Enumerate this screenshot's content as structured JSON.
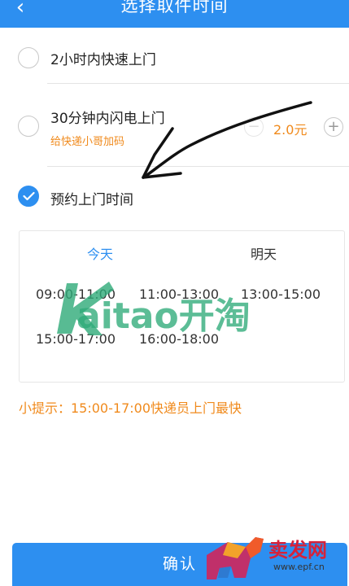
{
  "header": {
    "title": "选择取件时间",
    "back_icon": "chevron-left-icon",
    "background": "#2d8ff0"
  },
  "options": [
    {
      "label": "2小时内快速上门",
      "selected": false
    },
    {
      "label": "30分钟内闪电上门",
      "sublabel": "给快递小哥加码",
      "price": "2.0元",
      "selected": false
    },
    {
      "label": "预约上门时间",
      "selected": true
    }
  ],
  "schedule": {
    "tabs": [
      "今天",
      "明天"
    ],
    "active_tab": "今天",
    "slots": [
      "09:00-11:00",
      "11:00-13:00",
      "13:00-15:00",
      "15:00-17:00",
      "16:00-18:00"
    ]
  },
  "tip": "小提示：15:00-17:00快递员上门最快",
  "confirm_label": "确认",
  "watermark": {
    "brand": "kaitao开淘"
  },
  "corner_logo": {
    "text": "卖发网",
    "url": "www.epf.cn"
  },
  "colors": {
    "accent": "#2d8ff0",
    "orange": "#f08a1c",
    "divider": "#e4e4e4"
  }
}
